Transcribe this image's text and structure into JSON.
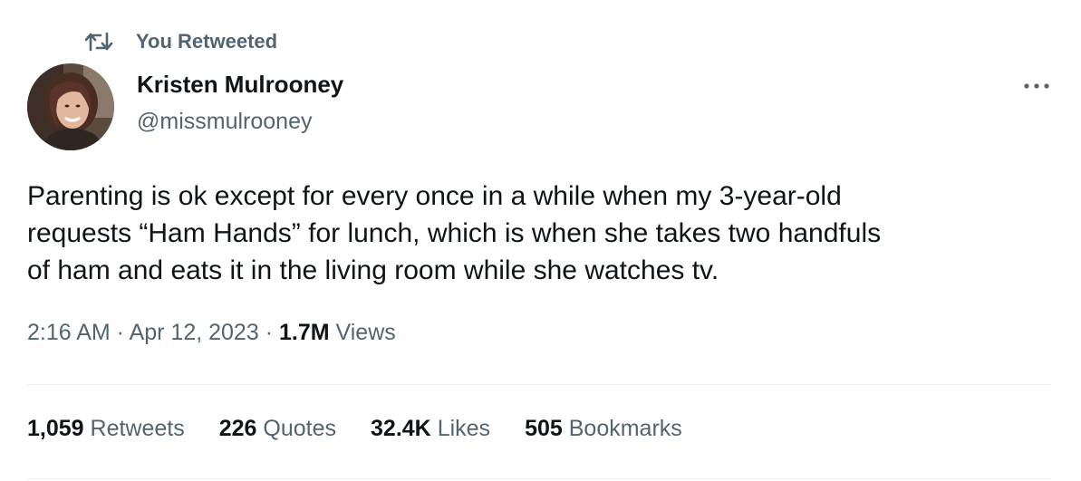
{
  "retweet": {
    "label": "You Retweeted",
    "icon": "retweet-icon"
  },
  "author": {
    "name": "Kristen Mulrooney",
    "handle": "@missmulrooney",
    "avatar_icon": "avatar"
  },
  "more_icon": "more-horizontal-icon",
  "tweet": {
    "lines": [
      "Parenting is ok except for every once in a while when my 3-year-old",
      "requests “Ham Hands” for lunch, which is when she takes two handfuls",
      "of ham and eats it in the living room while she watches tv."
    ]
  },
  "meta": {
    "time": "2:16 AM",
    "separator": " · ",
    "date": "Apr 12, 2023",
    "views_count": "1.7M",
    "views_label": "Views"
  },
  "stats": [
    {
      "count": "1,059",
      "label": "Retweets"
    },
    {
      "count": "226",
      "label": "Quotes"
    },
    {
      "count": "32.4K",
      "label": "Likes"
    },
    {
      "count": "505",
      "label": "Bookmarks"
    }
  ],
  "colors": {
    "primary_text": "#0f1419",
    "secondary_text": "#536471",
    "divider": "#eff3f4"
  }
}
